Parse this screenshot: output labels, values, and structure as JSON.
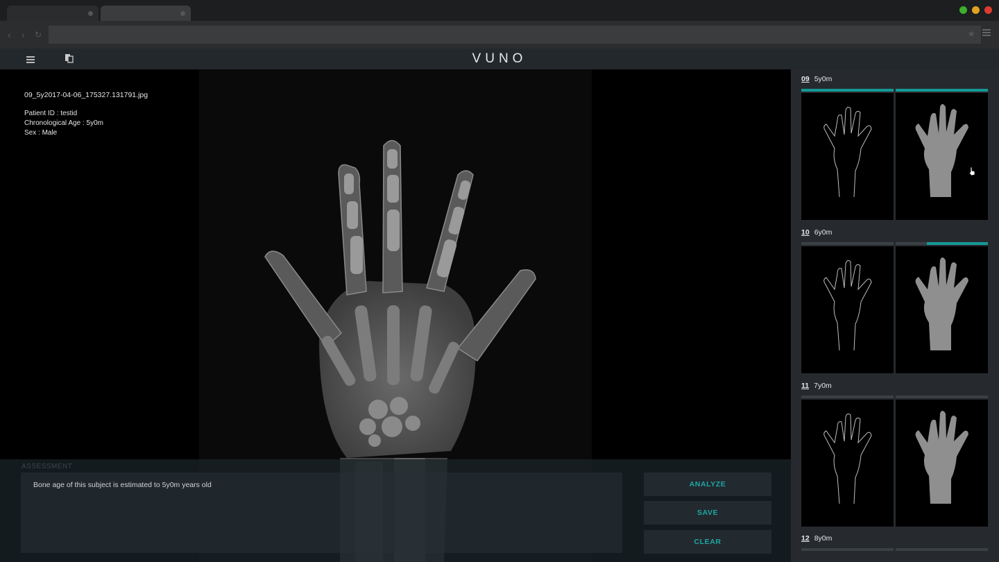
{
  "app": {
    "logo_text": "VUNO"
  },
  "browser": {
    "url_value": "",
    "window_buttons": {
      "minimize": "#3fae2a",
      "zoom": "#e0a31f",
      "close": "#dc3b30"
    }
  },
  "image_info": {
    "filename": "09_5y2017-04-06_175327.131791.jpg",
    "patient_id": "Patient ID : testid",
    "chronological_age": "Chronological Age : 5y0m",
    "sex": "Sex : Male"
  },
  "assessment": {
    "label": "ASSESSMENT",
    "text": "Bone age of this subject is estimated to 5y0m years old"
  },
  "actions": {
    "analyze": "ANALYZE",
    "save": "SAVE",
    "clear": "CLEAR"
  },
  "references": [
    {
      "num": "09",
      "age": "5y0m",
      "progress": 1.0
    },
    {
      "num": "10",
      "age": "6y0m",
      "progress": 0.66
    },
    {
      "num": "11",
      "age": "7y0m",
      "progress": 0.0
    },
    {
      "num": "12",
      "age": "8y0m",
      "progress": 0.0
    }
  ],
  "colors": {
    "accent": "#1fa7a3",
    "progress": "#159a95",
    "panel": "#262a2f"
  }
}
